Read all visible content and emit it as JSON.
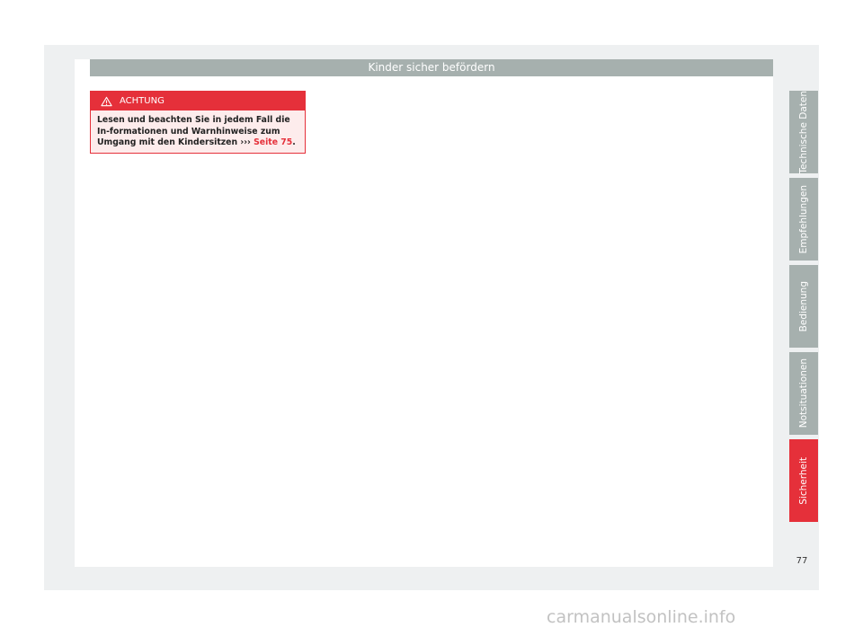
{
  "header": {
    "title": "Kinder sicher befördern"
  },
  "warning": {
    "icon": "warning-triangle-icon",
    "heading": "ACHTUNG",
    "text": "Lesen und beachten Sie in jedem Fall die In-formationen und Warnhinweise zum Umgang mit den Kindersitzen",
    "arrows": "›››",
    "link": "Seite 75",
    "end": ".",
    "color": "#e5303a"
  },
  "sidebar": {
    "tabs": [
      {
        "label": "Technische Daten",
        "active": false
      },
      {
        "label": "Empfehlungen",
        "active": false
      },
      {
        "label": "Bedienung",
        "active": false
      },
      {
        "label": "Notsituationen",
        "active": false
      },
      {
        "label": "Sicherheit",
        "active": true
      }
    ],
    "active_color": "#e5303a",
    "inactive_color": "#a6b0ae"
  },
  "footer": {
    "page_number": "77"
  },
  "watermark": {
    "text": "carmanualsonline.info"
  }
}
